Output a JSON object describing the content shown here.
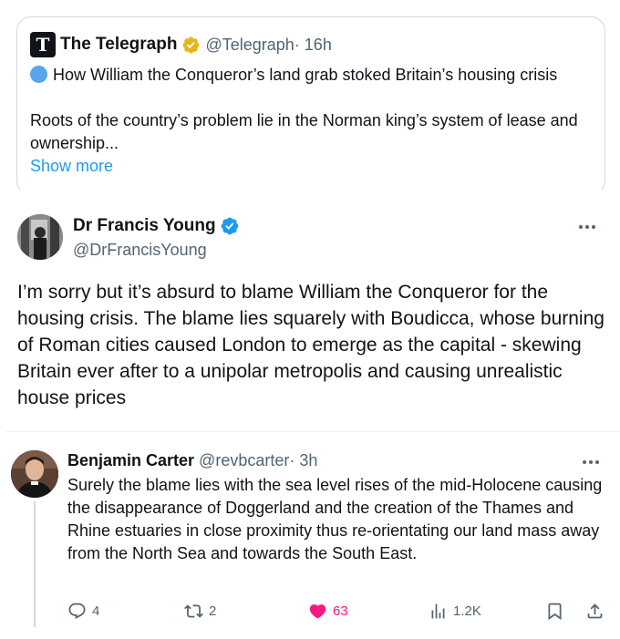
{
  "quoted": {
    "logo_glyph": "T",
    "name": "The Telegraph",
    "handle": "@Telegraph",
    "time": " · 16h",
    "headline": "How William the Conqueror’s land grab stoked Britain’s housing crisis",
    "summary": "Roots of the country’s problem lie in the Norman king’s system of lease and ownership...",
    "show_more": "Show more",
    "badge_color": "#e2b719"
  },
  "main": {
    "name": "Dr Francis Young",
    "handle": "@DrFrancisYoung",
    "text": "I’m sorry but it’s absurd to blame William the Conqueror for the housing crisis. The blame lies squarely with Boudicca, whose burning of Roman cities caused London to emerge as the capital - skewing Britain ever after to a unipolar metropolis and causing unrealistic house prices",
    "badge_color": "#1d9bf0"
  },
  "reply": {
    "name": "Benjamin Carter",
    "handle": "@revbcarter",
    "time": " · 3h",
    "text": "Surely the blame lies with the sea level rises of the mid-Holocene causing the disappearance of Doggerland and the creation of the Thames and Rhine estuaries in close proximity thus re-orientating our land mass away from the North Sea and towards the South East.",
    "actions": {
      "replies": "4",
      "retweets": "2",
      "likes": "63",
      "views": "1.2K"
    },
    "like_color": "#f91880"
  },
  "icons": [
    "chat-bubble-icon",
    "retweet-icon",
    "heart-icon",
    "views-bar-chart-icon",
    "bookmark-icon",
    "share-icon",
    "more-dots-icon",
    "verified-badge-icon"
  ]
}
